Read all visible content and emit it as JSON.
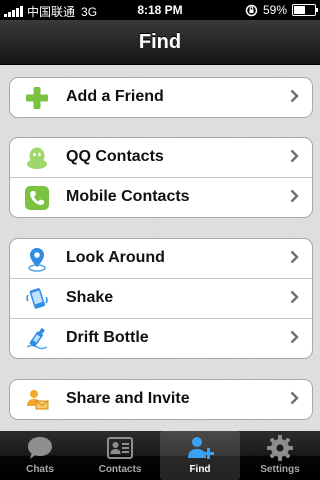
{
  "status_bar": {
    "carrier": "中国联通",
    "network": "3G",
    "time": "8:18 PM",
    "battery": "59%",
    "battery_level": 0.59
  },
  "navbar": {
    "title": "Find"
  },
  "groups": [
    {
      "items": [
        {
          "label": "Add a Friend",
          "icon": "add-friend-icon"
        }
      ]
    },
    {
      "items": [
        {
          "label": "QQ Contacts",
          "icon": "qq-icon"
        },
        {
          "label": "Mobile Contacts",
          "icon": "phone-icon"
        }
      ]
    },
    {
      "items": [
        {
          "label": "Look Around",
          "icon": "location-pin-icon"
        },
        {
          "label": "Shake",
          "icon": "shake-phone-icon"
        },
        {
          "label": "Drift Bottle",
          "icon": "bottle-icon"
        }
      ]
    },
    {
      "items": [
        {
          "label": "Share and Invite",
          "icon": "share-envelope-icon"
        }
      ]
    }
  ],
  "tabbar": {
    "tabs": [
      {
        "label": "Chats",
        "icon": "chat-bubble-icon",
        "active": false
      },
      {
        "label": "Contacts",
        "icon": "contact-card-icon",
        "active": false
      },
      {
        "label": "Find",
        "icon": "find-friend-icon",
        "active": true
      },
      {
        "label": "Settings",
        "icon": "gear-icon",
        "active": false
      }
    ]
  },
  "colors": {
    "accent_green": "#7cc242",
    "accent_blue": "#2f8de4",
    "navbar": "#1c1c1c",
    "background": "#dcdcdc"
  }
}
